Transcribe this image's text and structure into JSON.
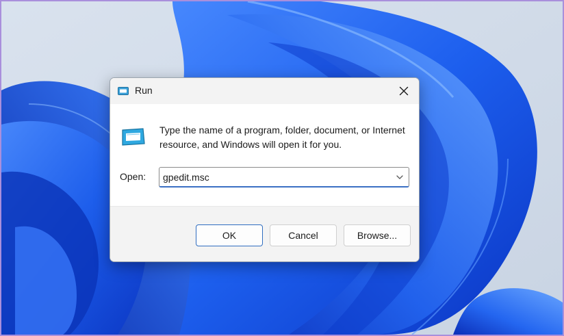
{
  "window": {
    "title": "Run",
    "icon": "run-icon",
    "close_icon": "close-icon"
  },
  "prompt": {
    "description": "Type the name of a program, folder, document, or Internet resource, and Windows will open it for you.",
    "icon": "run-icon"
  },
  "open_field": {
    "label": "Open:",
    "value": "gpedit.msc",
    "dropdown_icon": "chevron-down-icon"
  },
  "buttons": {
    "ok": "OK",
    "cancel": "Cancel",
    "browse": "Browse..."
  },
  "colors": {
    "accent": "#2f6dc0",
    "wallpaper_blue": "#1a5de8",
    "dialog_bg": "#ffffff",
    "chrome_bg": "#f3f3f3"
  }
}
